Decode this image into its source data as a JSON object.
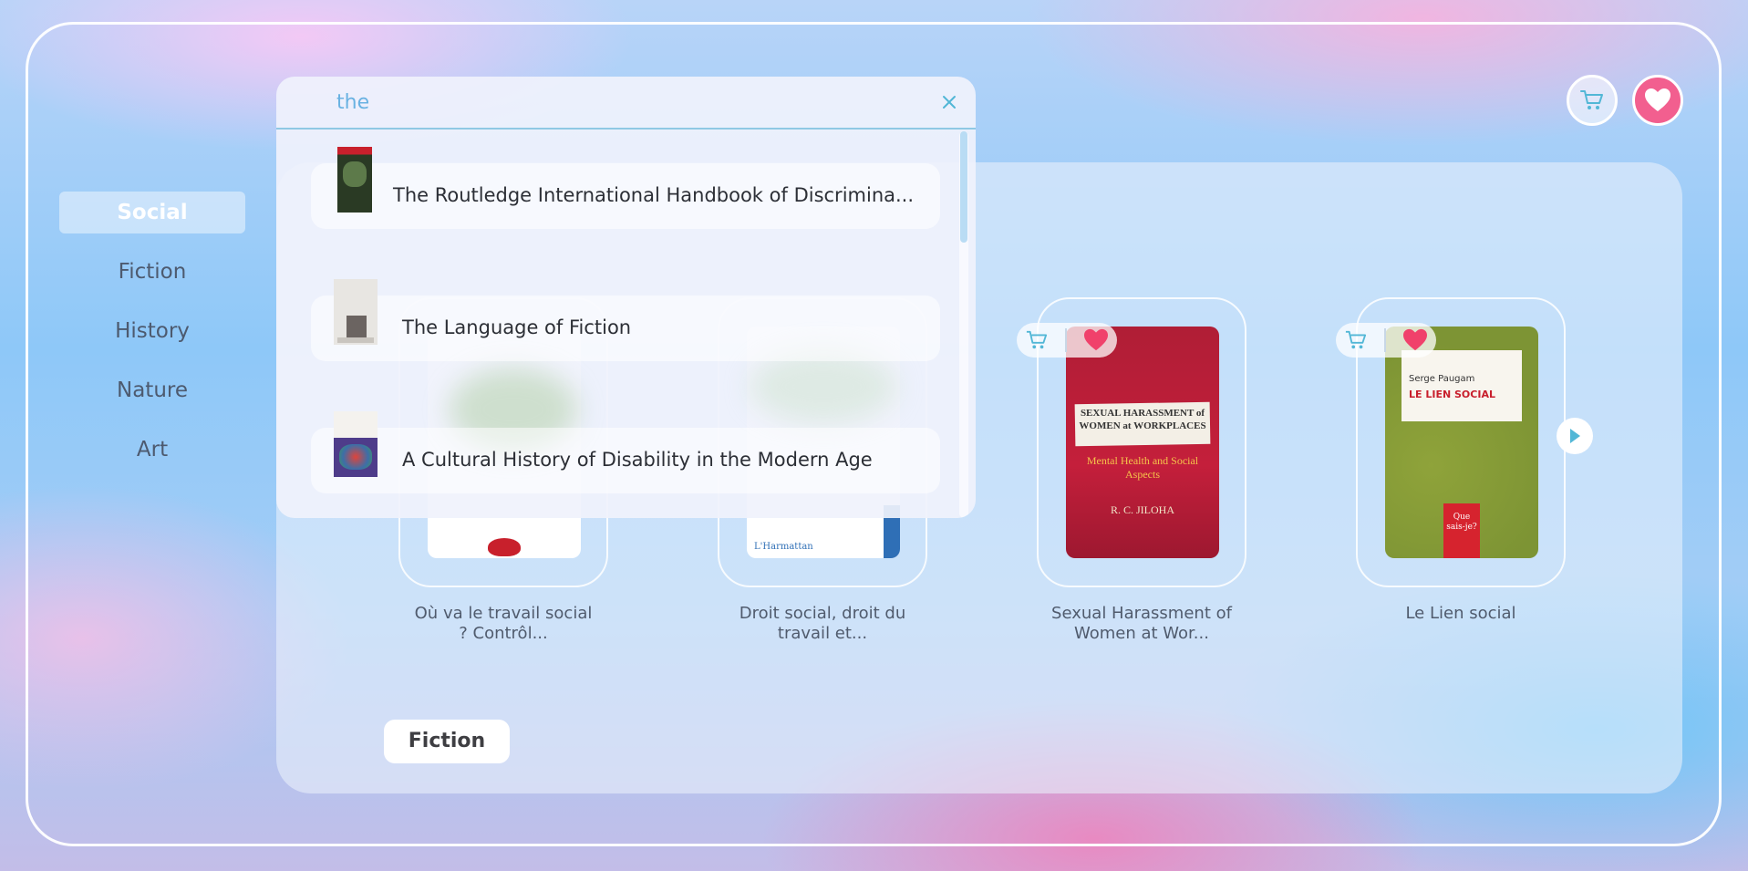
{
  "sidebar": {
    "items": [
      {
        "label": "Social",
        "active": true
      },
      {
        "label": "Fiction"
      },
      {
        "label": "History"
      },
      {
        "label": "Nature"
      },
      {
        "label": "Art"
      }
    ]
  },
  "header": {
    "cart_icon": "cart-icon",
    "favorites_icon": "heart-icon"
  },
  "search": {
    "query": "the",
    "clear_icon": "close-icon",
    "results": [
      {
        "title": "The Routledge International Handbook of Discrimina..."
      },
      {
        "title": "The Language of Fiction"
      },
      {
        "title": "A Cultural History of Disability in the Modern Age"
      }
    ]
  },
  "books": [
    {
      "title_line1": "Où va le travail social",
      "title_line2": "? Contrôl..."
    },
    {
      "title_line1": "Droit social, droit du",
      "title_line2": "travail et..."
    },
    {
      "title_line1": "Sexual Harassment of",
      "title_line2": "Women at Wor...",
      "cover_title": "SEXUAL HARASSMENT of WOMEN at WORKPLACES",
      "cover_sub": "Mental Health and Social Aspects",
      "cover_author": "R. C. JILOHA"
    },
    {
      "title_line1": "Le Lien social",
      "title_line2": "",
      "cover_author": "Serge Paugam",
      "cover_title": "LE LIEN SOCIAL",
      "cover_badge": "Que sais-je?"
    }
  ],
  "section_button": "Fiction",
  "colors": {
    "accent": "#52b7d6",
    "heart": "#f25f8f"
  }
}
